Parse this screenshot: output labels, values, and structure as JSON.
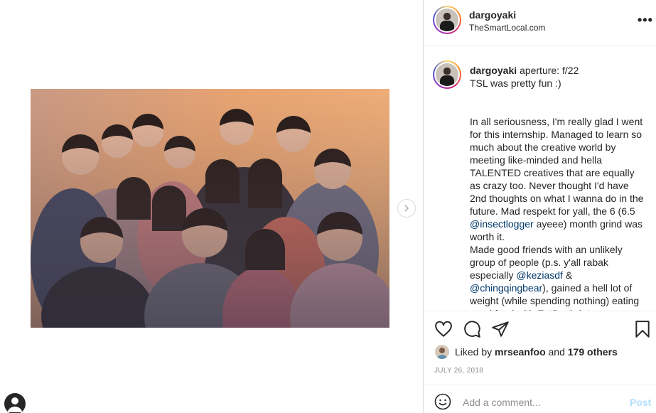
{
  "post": {
    "username": "dargoyaki",
    "location": "TheSmartLocal.com",
    "caption": {
      "username": "dargoyaki",
      "line1": "aperture: f/22",
      "line2": "TSL was pretty fun :)",
      "para1_a": "In all seriousness, I'm really glad I went for this internship. Managed to learn so much about the creative world by meeting like-minded and hella TALENTED creatives that are equally as crazy too. Never thought I'd have 2nd thoughts on what I wanna do in the future. Mad respekt for yall, the 6 (6.5 ",
      "mention1": "@insectlogger",
      "para1_b": " ayeee) month grind was worth it.",
      "para2_a": "Made good friends with an unlikely group of people (p.s. y'all rabak especially ",
      "mention2": "@keziasdf",
      "amp": " & ",
      "mention3": "@chingqingbear",
      "para2_b": "), gained a hell lot of weight (while spending nothing) eating good food with EatBook (ate"
    },
    "likes": {
      "prefix": "Liked by",
      "liker": "mrseanfoo",
      "and": "and",
      "others": "179 others"
    },
    "date": "JULY 26, 2018",
    "comment": {
      "placeholder": "Add a comment...",
      "post_label": "Post"
    }
  },
  "icons": {
    "more": "more-options-icon",
    "like": "heart-icon",
    "comment": "comment-icon",
    "share": "paper-plane-icon",
    "save": "bookmark-icon",
    "emoji": "emoji-icon",
    "next": "chevron-right-icon"
  },
  "colors": {
    "mention": "#00376b",
    "post_disabled": "#b2dffc",
    "muted": "#8e8e8e"
  }
}
